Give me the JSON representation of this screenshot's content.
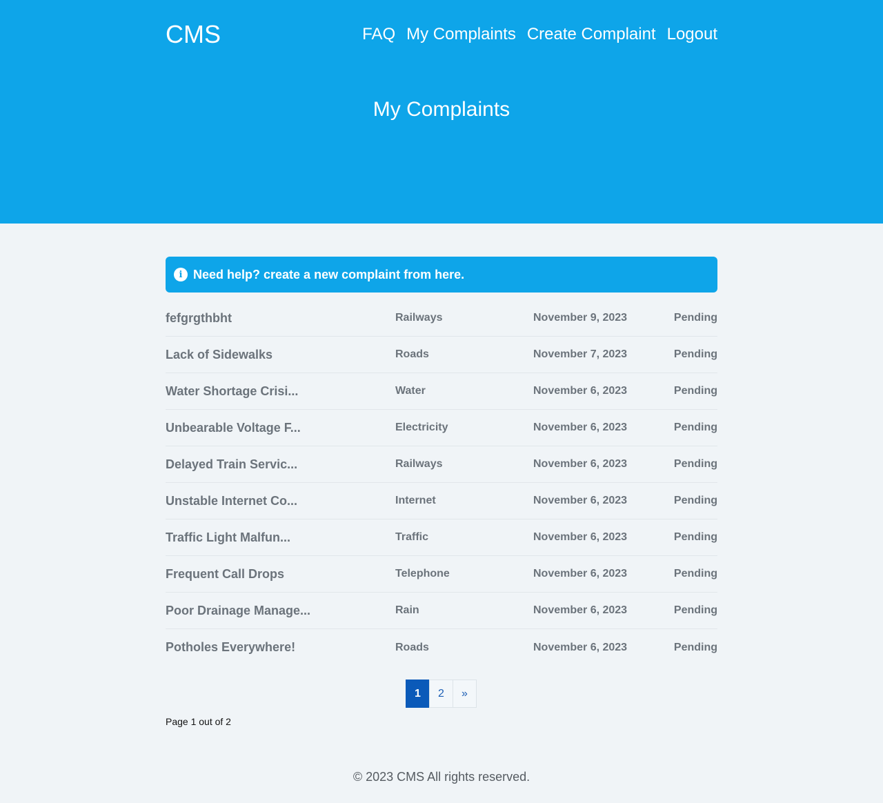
{
  "header": {
    "brand": "CMS",
    "nav": [
      "FAQ",
      "My Complaints",
      "Create Complaint",
      "Logout"
    ],
    "page_title": "My Complaints"
  },
  "alert": {
    "icon": "info-icon",
    "text": "Need help? create a new complaint from here."
  },
  "complaints": [
    {
      "title": "fefgrgthbht",
      "category": "Railways",
      "date": "November 9, 2023",
      "status": "Pending"
    },
    {
      "title": "Lack of Sidewalks",
      "category": "Roads",
      "date": "November 7, 2023",
      "status": "Pending"
    },
    {
      "title": "Water Shortage Crisi...",
      "category": "Water",
      "date": "November 6, 2023",
      "status": "Pending"
    },
    {
      "title": "Unbearable Voltage F...",
      "category": "Electricity",
      "date": "November 6, 2023",
      "status": "Pending"
    },
    {
      "title": "Delayed Train Servic...",
      "category": "Railways",
      "date": "November 6, 2023",
      "status": "Pending"
    },
    {
      "title": "Unstable Internet Co...",
      "category": "Internet",
      "date": "November 6, 2023",
      "status": "Pending"
    },
    {
      "title": "Traffic Light Malfun...",
      "category": "Traffic",
      "date": "November 6, 2023",
      "status": "Pending"
    },
    {
      "title": "Frequent Call Drops",
      "category": "Telephone",
      "date": "November 6, 2023",
      "status": "Pending"
    },
    {
      "title": "Poor Drainage Manage...",
      "category": "Rain",
      "date": "November 6, 2023",
      "status": "Pending"
    },
    {
      "title": "Potholes Everywhere!",
      "category": "Roads",
      "date": "November 6, 2023",
      "status": "Pending"
    }
  ],
  "pagination": {
    "pages": [
      "1",
      "2",
      "»"
    ],
    "active": "1",
    "info": "Page 1 out of 2"
  },
  "footer": {
    "text": "© 2023 CMS All rights reserved."
  },
  "colors": {
    "primary": "#0ea5e9",
    "page_bg": "#f0f4f7",
    "active_page": "#0b5ab9",
    "text_muted": "#6b737b"
  }
}
